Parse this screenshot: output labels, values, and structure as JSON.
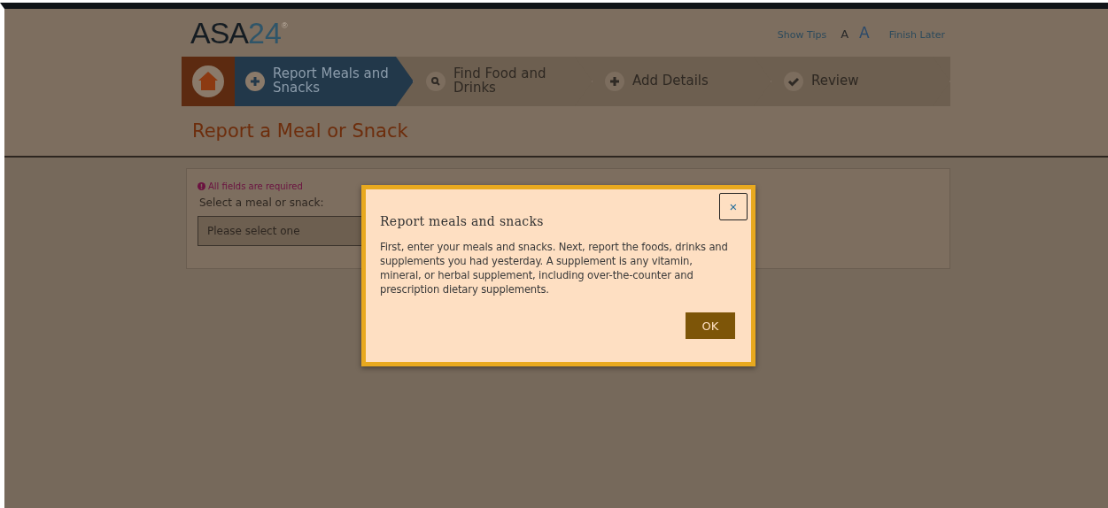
{
  "header": {
    "logo": {
      "name": "ASA",
      "number": "24",
      "mark": "®"
    },
    "links": [
      {
        "kind": "link",
        "label": "Show Tips"
      },
      {
        "kind": "font-small",
        "label": "A"
      },
      {
        "kind": "font-large",
        "label": "A"
      },
      {
        "kind": "link",
        "label": "Finish Later"
      }
    ]
  },
  "steps": [
    {
      "label": "Report Meals and Snacks",
      "selected": true
    },
    {
      "label": "Find Food and Drinks",
      "selected": false
    },
    {
      "label": "Add Details",
      "selected": false
    },
    {
      "label": "Review",
      "selected": false
    }
  ],
  "page_title": "Report a Meal or Snack",
  "form": {
    "notice": "All fields are required",
    "label": "Select a meal or snack:",
    "select_placeholder": "Please select one"
  },
  "dialog": {
    "title": "Report meals and snacks",
    "body": "First, enter your meals and snacks. Next, report the foods, drinks and supplements you had yesterday. A supplement is any vitamin, mineral, or herbal supplement, including over-the-counter and prescription dietary supplements.",
    "close": "×",
    "ok": "OK"
  }
}
